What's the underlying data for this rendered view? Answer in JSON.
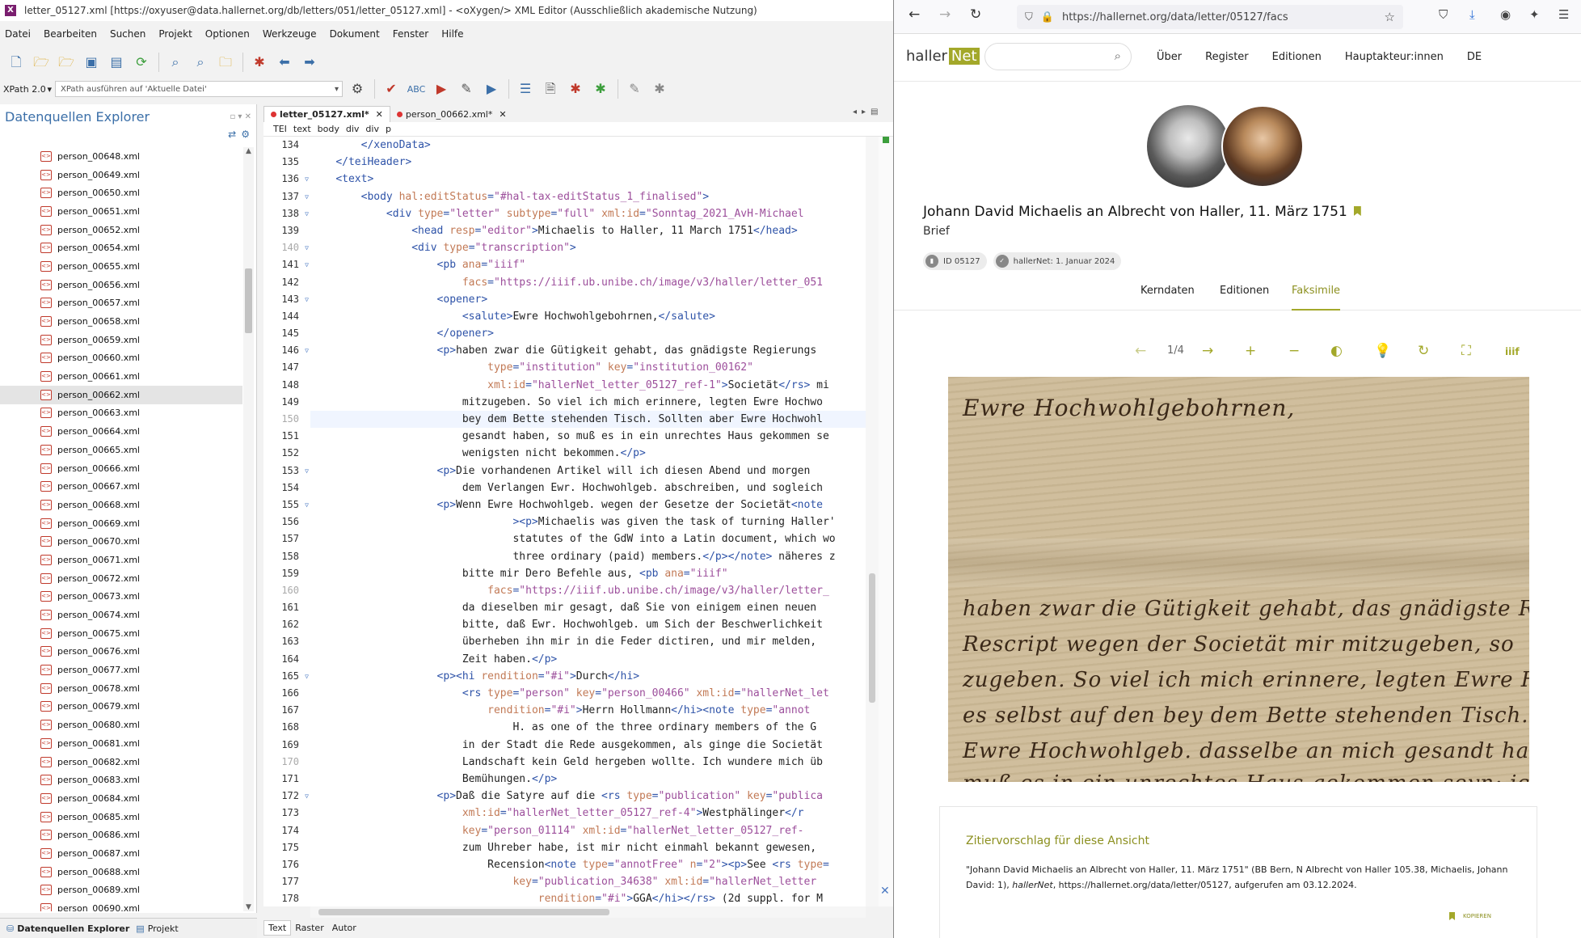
{
  "oxygen": {
    "title": "letter_05127.xml [https://oxyuser@data.hallernet.org/db/letters/051/letter_05127.xml] - <oXygen/> XML Editor (Ausschließlich akademische Nutzung)",
    "menu": [
      "Datei",
      "Bearbeiten",
      "Suchen",
      "Projekt",
      "Optionen",
      "Werkzeuge",
      "Dokument",
      "Fenster",
      "Hilfe"
    ],
    "xpath_version": "XPath 2.0",
    "xpath_placeholder": "XPath ausführen auf  'Aktuelle Datei'",
    "explorer_title": "Datenquellen Explorer",
    "files": [
      "person_00648.xml",
      "person_00649.xml",
      "person_00650.xml",
      "person_00651.xml",
      "person_00652.xml",
      "person_00654.xml",
      "person_00655.xml",
      "person_00656.xml",
      "person_00657.xml",
      "person_00658.xml",
      "person_00659.xml",
      "person_00660.xml",
      "person_00661.xml",
      "person_00662.xml",
      "person_00663.xml",
      "person_00664.xml",
      "person_00665.xml",
      "person_00666.xml",
      "person_00667.xml",
      "person_00668.xml",
      "person_00669.xml",
      "person_00670.xml",
      "person_00671.xml",
      "person_00672.xml",
      "person_00673.xml",
      "person_00674.xml",
      "person_00675.xml",
      "person_00676.xml",
      "person_00677.xml",
      "person_00678.xml",
      "person_00679.xml",
      "person_00680.xml",
      "person_00681.xml",
      "person_00682.xml",
      "person_00683.xml",
      "person_00684.xml",
      "person_00685.xml",
      "person_00686.xml",
      "person_00687.xml",
      "person_00688.xml",
      "person_00689.xml",
      "person_00690.xml"
    ],
    "selected_file": "person_00662.xml",
    "bottom_tabs": [
      "Datenquellen Explorer",
      "Projekt"
    ],
    "editor_tabs": [
      "letter_05127.xml*",
      "person_00662.xml*"
    ],
    "breadcrumb": [
      "TEI",
      "text",
      "body",
      "div",
      "div",
      "p"
    ],
    "edit_modes": [
      "Text",
      "Raster",
      "Autor"
    ],
    "line_numbers": [
      "134",
      "135",
      "136",
      "137",
      "138",
      "139",
      "140",
      "141",
      "142",
      "143",
      "144",
      "145",
      "146",
      "147",
      "148",
      "149",
      "150",
      "151",
      "152",
      "153",
      "154",
      "155",
      "156",
      "157",
      "158",
      "159",
      "160",
      "161",
      "162",
      "163",
      "164",
      "165",
      "166",
      "167",
      "168",
      "169",
      "170",
      "171",
      "172",
      "173",
      "174",
      "175",
      "176",
      "177",
      "178"
    ],
    "code_lines": [
      [
        [
          "tx",
          "        "
        ],
        [
          "tg",
          "</xenoData>"
        ]
      ],
      [
        [
          "tx",
          "    "
        ],
        [
          "tg",
          "</teiHeader>"
        ]
      ],
      [
        [
          "tx",
          "    "
        ],
        [
          "tg",
          "<text>"
        ]
      ],
      [
        [
          "tx",
          "        "
        ],
        [
          "tg",
          "<body "
        ],
        [
          "an",
          "hal:editStatus"
        ],
        [
          "tg",
          "="
        ],
        [
          "av",
          "\"#hal-tax-editStatus_1_finalised\""
        ],
        [
          "tg",
          ">"
        ]
      ],
      [
        [
          "tx",
          "            "
        ],
        [
          "tg",
          "<div "
        ],
        [
          "an",
          "type"
        ],
        [
          "tg",
          "="
        ],
        [
          "av",
          "\"letter\" "
        ],
        [
          "an",
          "subtype"
        ],
        [
          "tg",
          "="
        ],
        [
          "av",
          "\"full\" "
        ],
        [
          "an",
          "xml:id"
        ],
        [
          "tg",
          "="
        ],
        [
          "av",
          "\"Sonntag_2021_AvH-Michael"
        ]
      ],
      [
        [
          "tx",
          "                "
        ],
        [
          "tg",
          "<head "
        ],
        [
          "an",
          "resp"
        ],
        [
          "tg",
          "="
        ],
        [
          "av",
          "\"editor\""
        ],
        [
          "tg",
          ">"
        ],
        [
          "tx",
          "Michaelis to Haller, 11 March 1751"
        ],
        [
          "tg",
          "</head>"
        ]
      ],
      [
        [
          "tx",
          "                "
        ],
        [
          "tg",
          "<div "
        ],
        [
          "an",
          "type"
        ],
        [
          "tg",
          "="
        ],
        [
          "av",
          "\"transcription\""
        ],
        [
          "tg",
          ">"
        ]
      ],
      [
        [
          "tx",
          "                    "
        ],
        [
          "tg",
          "<pb "
        ],
        [
          "an",
          "ana"
        ],
        [
          "tg",
          "="
        ],
        [
          "av",
          "\"iiif\""
        ]
      ],
      [
        [
          "tx",
          "                        "
        ],
        [
          "an",
          "facs"
        ],
        [
          "tg",
          "="
        ],
        [
          "av",
          "\"https://iiif.ub.unibe.ch/image/v3/haller/letter_051"
        ]
      ],
      [
        [
          "tx",
          "                    "
        ],
        [
          "tg",
          "<opener>"
        ]
      ],
      [
        [
          "tx",
          "                        "
        ],
        [
          "tg",
          "<salute>"
        ],
        [
          "tx",
          "Ewre Hochwohlgebohrnen,"
        ],
        [
          "tg",
          "</salute>"
        ]
      ],
      [
        [
          "tx",
          "                    "
        ],
        [
          "tg",
          "</opener>"
        ]
      ],
      [
        [
          "tx",
          "                    "
        ],
        [
          "tg",
          "<p>"
        ],
        [
          "tx",
          "haben zwar die Gütigkeit gehabt, das gnädigste Regierungs"
        ]
      ],
      [
        [
          "tx",
          "                            "
        ],
        [
          "an",
          "type"
        ],
        [
          "tg",
          "="
        ],
        [
          "av",
          "\"institution\" "
        ],
        [
          "an",
          "key"
        ],
        [
          "tg",
          "="
        ],
        [
          "av",
          "\"institution_00162\""
        ]
      ],
      [
        [
          "tx",
          "                            "
        ],
        [
          "an",
          "xml:id"
        ],
        [
          "tg",
          "="
        ],
        [
          "av",
          "\"hallerNet_letter_05127_ref-1\""
        ],
        [
          "tg",
          ">"
        ],
        [
          "tx",
          "Societät"
        ],
        [
          "tg",
          "</rs>"
        ],
        [
          "tx",
          " mi"
        ]
      ],
      [
        [
          "tx",
          "                        mitzugeben. So viel ich mich erinnere, legten Ewre Hochwo"
        ]
      ],
      [
        [
          "tx",
          "                        bey dem Bette stehenden Tisch. Sollten aber Ewre Hochwohl"
        ]
      ],
      [
        [
          "tx",
          "                        gesandt haben, so muß es in ein unrechtes Haus gekommen se"
        ]
      ],
      [
        [
          "tx",
          "                        wenigsten nicht bekommen."
        ],
        [
          "tg",
          "</p>"
        ]
      ],
      [
        [
          "tx",
          "                    "
        ],
        [
          "tg",
          "<p>"
        ],
        [
          "tx",
          "Die vorhandenen Artikel will ich diesen Abend und morgen "
        ]
      ],
      [
        [
          "tx",
          "                        dem Verlangen Ewr. Hochwohlgeb. abschreiben, und sogleich"
        ]
      ],
      [
        [
          "tx",
          "                    "
        ],
        [
          "tg",
          "<p>"
        ],
        [
          "tx",
          "Wenn Ewre Hochwohlgeb. wegen der Gesetze der Societät"
        ],
        [
          "tg",
          "<note"
        ]
      ],
      [
        [
          "tx",
          "                                "
        ],
        [
          "tg",
          "><p>"
        ],
        [
          "tx",
          "Michaelis was given the task of turning Haller'"
        ]
      ],
      [
        [
          "tx",
          "                                statutes of the GdW into a Latin document, which wo"
        ]
      ],
      [
        [
          "tx",
          "                                three ordinary (paid) members."
        ],
        [
          "tg",
          "</p></note>"
        ],
        [
          "tx",
          " näheres z"
        ]
      ],
      [
        [
          "tx",
          "                        bitte mir Dero Befehle aus, "
        ],
        [
          "tg",
          "<pb "
        ],
        [
          "an",
          "ana"
        ],
        [
          "tg",
          "="
        ],
        [
          "av",
          "\"iiif\""
        ]
      ],
      [
        [
          "tx",
          "                            "
        ],
        [
          "an",
          "facs"
        ],
        [
          "tg",
          "="
        ],
        [
          "av",
          "\"https://iiif.ub.unibe.ch/image/v3/haller/letter_"
        ]
      ],
      [
        [
          "tx",
          "                        da dieselben mir gesagt, daß Sie von einigem einen neuen "
        ]
      ],
      [
        [
          "tx",
          "                        bitte, daß Ewr. Hochwohlgeb. um Sich der Beschwerlichkeit"
        ]
      ],
      [
        [
          "tx",
          "                        überheben ihn mir in die Feder dictiren, und mir melden, "
        ]
      ],
      [
        [
          "tx",
          "                        Zeit haben."
        ],
        [
          "tg",
          "</p>"
        ]
      ],
      [
        [
          "tx",
          "                    "
        ],
        [
          "tg",
          "<p><hi "
        ],
        [
          "an",
          "rendition"
        ],
        [
          "tg",
          "="
        ],
        [
          "av",
          "\"#i\""
        ],
        [
          "tg",
          ">"
        ],
        [
          "tx",
          "Durch"
        ],
        [
          "tg",
          "</hi>"
        ]
      ],
      [
        [
          "tx",
          "                        "
        ],
        [
          "tg",
          "<rs "
        ],
        [
          "an",
          "type"
        ],
        [
          "tg",
          "="
        ],
        [
          "av",
          "\"person\" "
        ],
        [
          "an",
          "key"
        ],
        [
          "tg",
          "="
        ],
        [
          "av",
          "\"person_00466\" "
        ],
        [
          "an",
          "xml:id"
        ],
        [
          "tg",
          "="
        ],
        [
          "av",
          "\"hallerNet_let"
        ]
      ],
      [
        [
          "tx",
          "                            "
        ],
        [
          "an",
          "rendition"
        ],
        [
          "tg",
          "="
        ],
        [
          "av",
          "\"#i\""
        ],
        [
          "tg",
          ">"
        ],
        [
          "tx",
          "Herrn Hollmann"
        ],
        [
          "tg",
          "</hi><note "
        ],
        [
          "an",
          "type"
        ],
        [
          "tg",
          "="
        ],
        [
          "av",
          "\"annot"
        ]
      ],
      [
        [
          "tx",
          "                                H. as one of the three ordinary members of the G"
        ]
      ],
      [
        [
          "tx",
          "                        in der Stadt die Rede ausgekommen, als ginge die Societät"
        ]
      ],
      [
        [
          "tx",
          "                        Landschaft kein Geld hergeben wollte. Ich wundere mich üb"
        ]
      ],
      [
        [
          "tx",
          "                        Bemühungen."
        ],
        [
          "tg",
          "</p>"
        ]
      ],
      [
        [
          "tx",
          "                    "
        ],
        [
          "tg",
          "<p>"
        ],
        [
          "tx",
          "Daß die Satyre auf die "
        ],
        [
          "tg",
          "<rs "
        ],
        [
          "an",
          "type"
        ],
        [
          "tg",
          "="
        ],
        [
          "av",
          "\"publication\" "
        ],
        [
          "an",
          "key"
        ],
        [
          "tg",
          "="
        ],
        [
          "av",
          "\"publica"
        ]
      ],
      [
        [
          "tx",
          "                        "
        ],
        [
          "an",
          "xml:id"
        ],
        [
          "tg",
          "="
        ],
        [
          "av",
          "\"hallerNet_letter_05127_ref-4\""
        ],
        [
          "tg",
          ">"
        ],
        [
          "tx",
          "Westphälinger"
        ],
        [
          "tg",
          "</r"
        ]
      ],
      [
        [
          "tx",
          "                        "
        ],
        [
          "an",
          "key"
        ],
        [
          "tg",
          "="
        ],
        [
          "av",
          "\"person_01114\" "
        ],
        [
          "an",
          "xml:id"
        ],
        [
          "tg",
          "="
        ],
        [
          "av",
          "\"hallerNet_letter_05127_ref-"
        ]
      ],
      [
        [
          "tx",
          "                        zum Uhreber habe, ist mir nicht einmahl bekannt gewesen,"
        ]
      ],
      [
        [
          "tx",
          "                            Recension"
        ],
        [
          "tg",
          "<note "
        ],
        [
          "an",
          "type"
        ],
        [
          "tg",
          "="
        ],
        [
          "av",
          "\"annotFree\" "
        ],
        [
          "an",
          "n"
        ],
        [
          "tg",
          "="
        ],
        [
          "av",
          "\"2\""
        ],
        [
          "tg",
          "><p>"
        ],
        [
          "tx",
          "See "
        ],
        [
          "tg",
          "<rs "
        ],
        [
          "an",
          "type"
        ],
        [
          "tg",
          "="
        ]
      ],
      [
        [
          "tx",
          "                                "
        ],
        [
          "an",
          "key"
        ],
        [
          "tg",
          "="
        ],
        [
          "av",
          "\"publication_34638\" "
        ],
        [
          "an",
          "xml:id"
        ],
        [
          "tg",
          "="
        ],
        [
          "av",
          "\"hallerNet_letter"
        ]
      ],
      [
        [
          "tx",
          "                                    "
        ],
        [
          "an",
          "rendition"
        ],
        [
          "tg",
          "="
        ],
        [
          "av",
          "\"#i\""
        ],
        [
          "tg",
          ">"
        ],
        [
          "tx",
          "GGA"
        ],
        [
          "tg",
          "</hi></rs>"
        ],
        [
          "tx",
          " (2d suppl. for M"
        ]
      ]
    ]
  },
  "browser": {
    "url": "https://hallernet.org/data/letter/05127/facs",
    "site_logo_a": "haller",
    "site_logo_b": "Net",
    "nav": [
      "Über",
      "Register",
      "Editionen",
      "Hauptakteur:innen",
      "DE"
    ],
    "doc_title": "Johann David Michaelis an Albrecht von Haller, 11. März 1751",
    "doc_type": "Brief",
    "badge_id": "ID 05127",
    "badge_date": "hallerNet: 1. Januar 2024",
    "tabs": [
      "Kerndaten",
      "Editionen",
      "Faksimile"
    ],
    "active_tab": "Faksimile",
    "page_indicator": "1/4",
    "cite_title": "Zitiervorschlag für diese Ansicht",
    "cite_text_a": "\"Johann David Michaelis an Albrecht von Haller, 11. März 1751\" (BB Bern, N Albrecht von Haller 105.38, Michaelis, Johann David: 1), ",
    "cite_text_em": "hallerNet",
    "cite_text_b": ", https://hallernet.org/data/letter/05127, aufgerufen am 03.12.2024.",
    "copy_label": "KOPIEREN",
    "colors": {
      "accent": "#a3a82a",
      "accent_dark": "#8c9020"
    }
  }
}
